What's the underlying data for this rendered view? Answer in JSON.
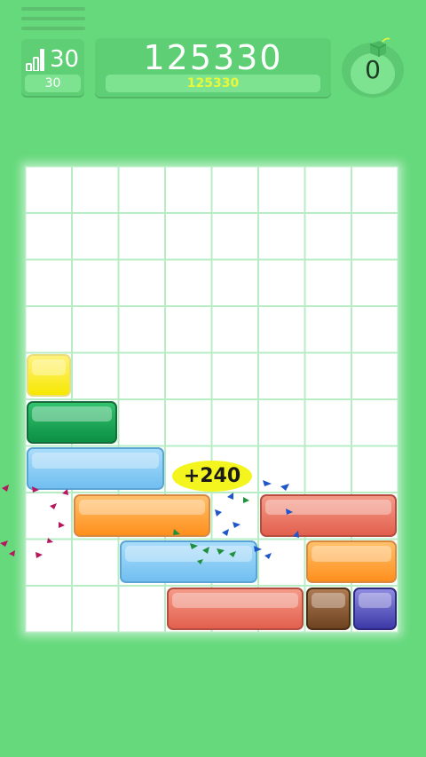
{
  "level": {
    "value": "30",
    "sub_value": "30"
  },
  "score": {
    "current": "125330",
    "best": "125330"
  },
  "bomb": {
    "count": "0"
  },
  "popup": {
    "text": "+240"
  },
  "icons": {
    "menu": "hamburger-menu-icon",
    "level": "signal-bars-icon",
    "bomb": "bomb-icon"
  },
  "colors": {
    "background": "#66d97c",
    "panel": "#5fcf75",
    "best_score_text": "#e8f73a",
    "popup": "#f4f41e"
  },
  "board": {
    "columns": 8,
    "rows": 10,
    "blocks": [
      {
        "row": 4,
        "col": 0,
        "span": 1,
        "color": "yellow"
      },
      {
        "row": 5,
        "col": 0,
        "span": 2,
        "color": "green"
      },
      {
        "row": 6,
        "col": 0,
        "span": 3,
        "color": "blue"
      },
      {
        "row": 7,
        "col": 1,
        "span": 3,
        "color": "orange"
      },
      {
        "row": 7,
        "col": 5,
        "span": 3,
        "color": "red"
      },
      {
        "row": 8,
        "col": 2,
        "span": 3,
        "color": "blue"
      },
      {
        "row": 8,
        "col": 6,
        "span": 2,
        "color": "orange"
      },
      {
        "row": 9,
        "col": 3,
        "span": 3,
        "color": "red"
      },
      {
        "row": 9,
        "col": 6,
        "span": 1,
        "color": "brown"
      },
      {
        "row": 9,
        "col": 7,
        "span": 1,
        "color": "navy"
      }
    ]
  }
}
